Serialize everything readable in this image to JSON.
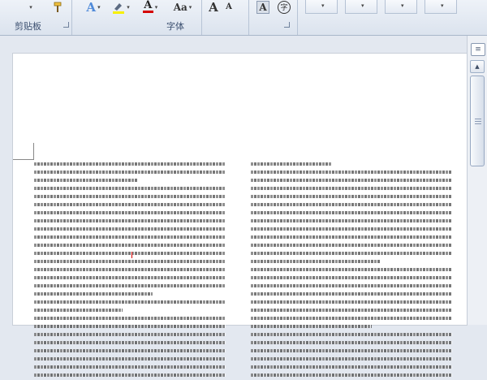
{
  "ribbon": {
    "clipboard_label": "剪贴板",
    "font_label": "字体",
    "font_size_glyph": "Aa",
    "grow_font_glyph": "A",
    "shrink_font_glyph": "A",
    "clear_format_glyph": "A",
    "phonetic_glyph": "字",
    "font_color_glyph": "A",
    "text_effect_glyph": "A",
    "dropdown_glyph": "▾",
    "accent_color": "#d40000",
    "highlight_color": "#f7f000"
  },
  "document": {
    "left_column_lines": 27,
    "right_column_lines": 27
  },
  "scrollbar": {
    "up_glyph": "▲",
    "down_glyph": "▼",
    "ruler_icon": "ruler-toggle-icon"
  }
}
